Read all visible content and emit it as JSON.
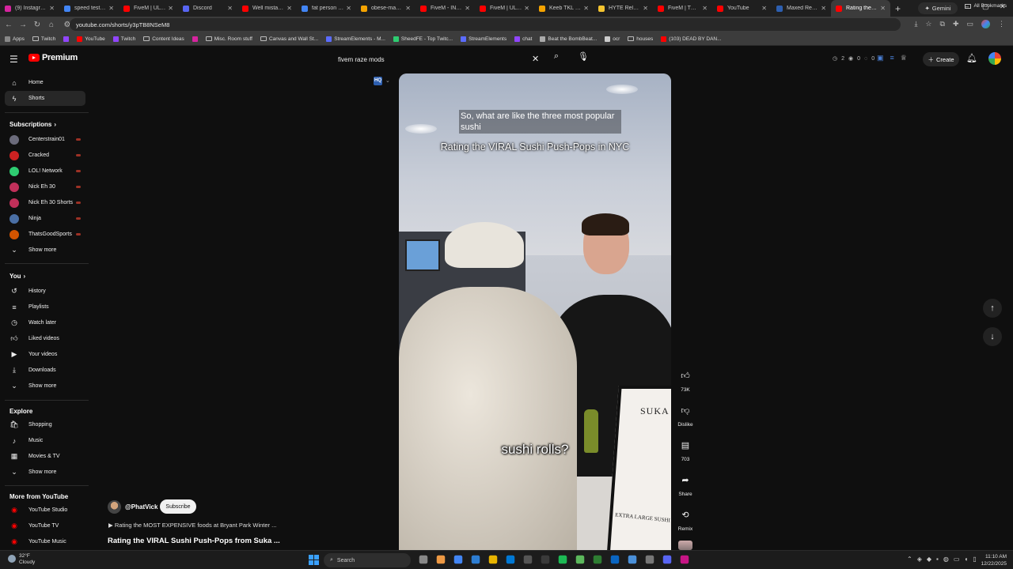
{
  "browser": {
    "tabs": [
      {
        "title": "(9) Instagram",
        "color": "#d6249f"
      },
      {
        "title": "speed test - Go",
        "color": "#4285f4"
      },
      {
        "title": "FiveM | ULTIM",
        "color": "#ff0000"
      },
      {
        "title": "Discord",
        "color": "#5865f2"
      },
      {
        "title": "Well mistakes",
        "color": "#ff0000"
      },
      {
        "title": "fat person - Go",
        "color": "#4285f4"
      },
      {
        "title": "obese-man-sh",
        "color": "#f4a300"
      },
      {
        "title": "FiveM - INSAN",
        "color": "#ff0000"
      },
      {
        "title": "FiveM | ULTIM",
        "color": "#ff0000"
      },
      {
        "title": "Keeb TKL Key",
        "color": "#f4a300"
      },
      {
        "title": "HYTE Release",
        "color": "#f4c430"
      },
      {
        "title": "FiveM | TOP T",
        "color": "#ff0000"
      },
      {
        "title": "YouTube",
        "color": "#ff0000"
      },
      {
        "title": "Maxed Realist",
        "color": "#2d5fb0"
      },
      {
        "title": "Rating the VIR",
        "color": "#ff0000",
        "active": true
      }
    ],
    "gemini_label": "Gemini",
    "url": "youtube.com/shorts/y3pTB8NSeM8",
    "bookmarks": [
      {
        "label": "Apps",
        "kind": "apps"
      },
      {
        "label": "Twitch",
        "kind": "folder"
      },
      {
        "label": "",
        "kind": "twitch"
      },
      {
        "label": "YouTube",
        "kind": "youtube"
      },
      {
        "label": "Twitch",
        "kind": "twitch"
      },
      {
        "label": "Content Ideas",
        "kind": "folder"
      },
      {
        "label": "",
        "kind": "insta"
      },
      {
        "label": "Misc. Room stuff",
        "kind": "folder"
      },
      {
        "label": "Canvas and Wall St...",
        "kind": "folder"
      },
      {
        "label": "StreamElements - M...",
        "kind": "se"
      },
      {
        "label": "SheedFE - Top Twitc...",
        "kind": "sheed"
      },
      {
        "label": "StreamElements",
        "kind": "se"
      },
      {
        "label": "chat",
        "kind": "twitch"
      },
      {
        "label": "Beat the BombBeat...",
        "kind": "bomb"
      },
      {
        "label": "ocr",
        "kind": "ocr"
      },
      {
        "label": "houses",
        "kind": "folder"
      },
      {
        "label": "(103) DEAD BY DAN...",
        "kind": "yt2"
      }
    ],
    "all_bookmarks": "All Bookmarks"
  },
  "youtube": {
    "logo_text": "Premium",
    "search_value": "fivem raze mods",
    "stats": {
      "a": "2",
      "b": "0",
      "c": "0"
    },
    "create_label": "Create",
    "sidebar": {
      "home": "Home",
      "shorts": "Shorts",
      "subscriptions_heading": "Subscriptions",
      "channels": [
        {
          "name": "Centerstrain01",
          "color": "#6b6b7b"
        },
        {
          "name": "Cracked",
          "color": "#cc2222"
        },
        {
          "name": "LOL! Network",
          "color": "#2ecc71"
        },
        {
          "name": "Nick Eh 30",
          "color": "#c0305a"
        },
        {
          "name": "Nick Eh 30 Shorts",
          "color": "#c0305a"
        },
        {
          "name": "Ninja",
          "color": "#4a6fa5"
        },
        {
          "name": "ThatsGoodSports",
          "color": "#d35400"
        }
      ],
      "show_more": "Show more",
      "you_heading": "You",
      "you_items": [
        "History",
        "Playlists",
        "Watch later",
        "Liked videos",
        "Your videos",
        "Downloads"
      ],
      "explore_heading": "Explore",
      "explore_items": [
        "Shopping",
        "Music",
        "Movies & TV"
      ],
      "more_heading": "More from YouTube",
      "more_items": [
        "YouTube Studio",
        "YouTube TV",
        "YouTube Music"
      ]
    },
    "short": {
      "caption_top": "So, what are like the three most popular sushi",
      "title_overlay": "Rating the VIRAL Sushi Push-Pops in NYC",
      "caption_mid": "sushi rolls?",
      "sign_text": "SUKA",
      "sign_bottom": "EXTRA LARGE SUSHI",
      "hq_badge": "HQ"
    },
    "actions": {
      "likes": "73K",
      "dislike": "Dislike",
      "comments": "703",
      "share": "Share",
      "remix": "Remix"
    },
    "channel": {
      "handle": "@PhatVick",
      "subscribe": "Subscribe",
      "related": "Rating the MOST EXPENSIVE foods at Bryant Park Winter ...",
      "video_title": "Rating the VIRAL Sushi Push-Pops from Suka ..."
    }
  },
  "taskbar": {
    "weather_temp": "32°F",
    "weather_desc": "Cloudy",
    "search_placeholder": "Search",
    "time": "11:10 AM",
    "date": "12/22/2025"
  }
}
